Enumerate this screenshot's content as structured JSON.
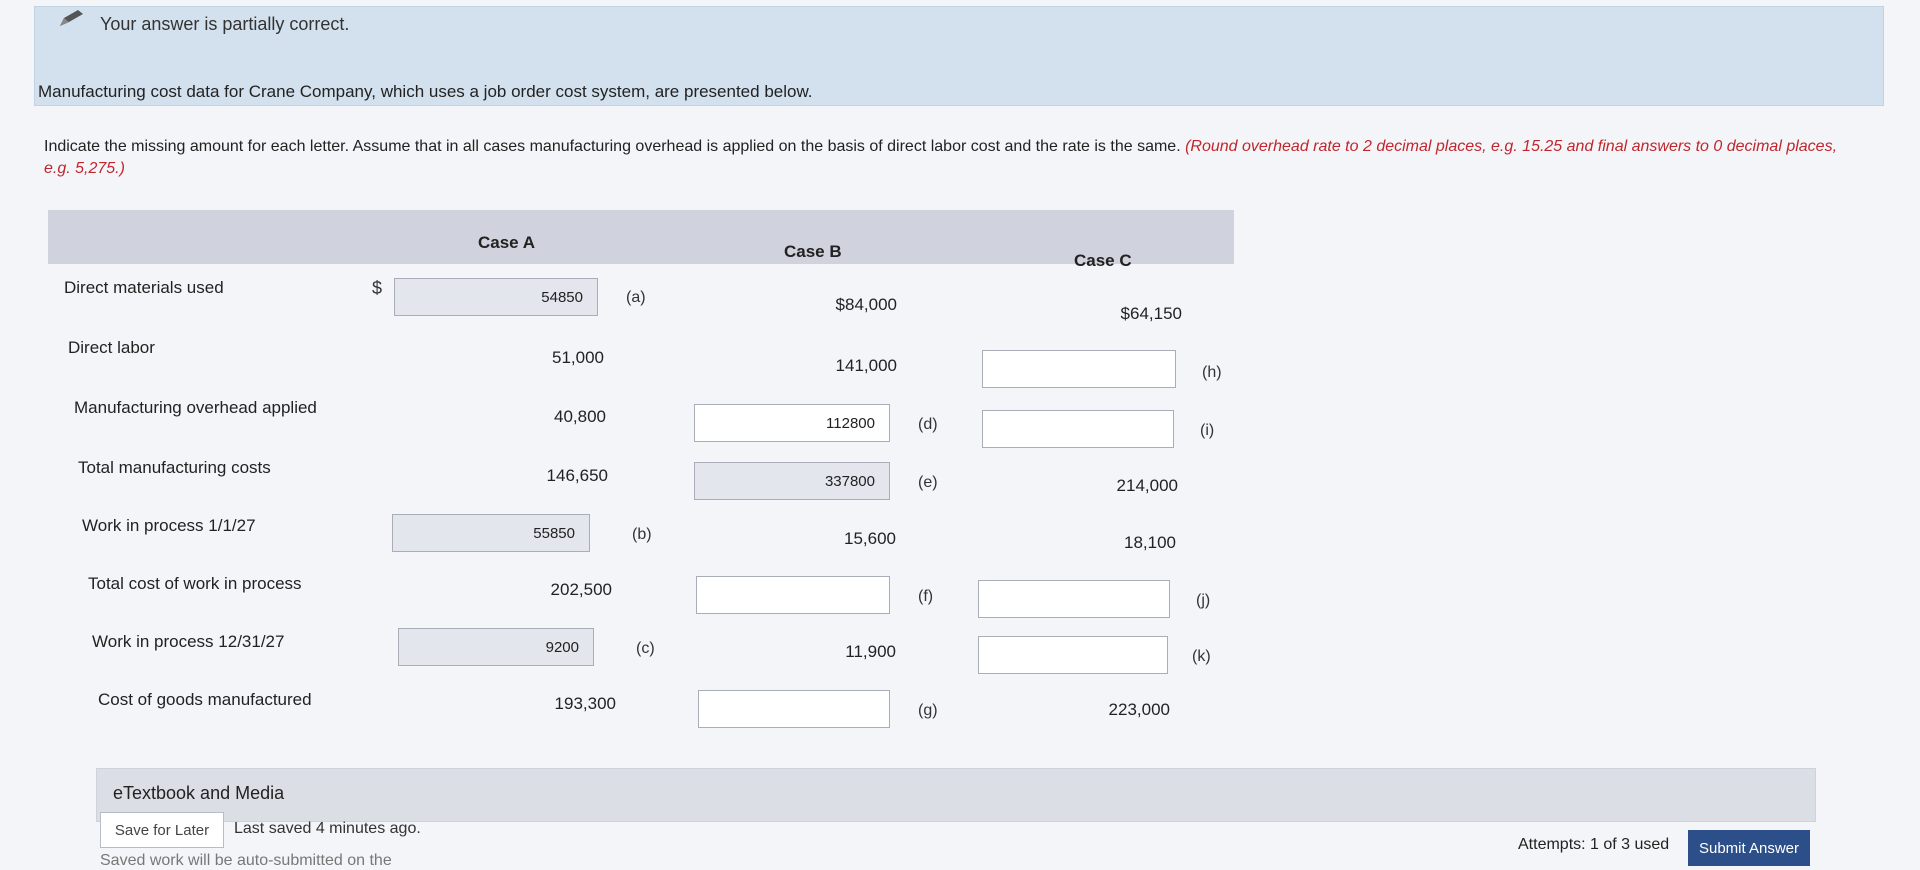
{
  "banner": {
    "text": "Your answer is partially correct.",
    "icon": "pencil-icon"
  },
  "intro": "Manufacturing cost data for Crane Company, which uses a job order cost system, are presented below.",
  "instructions": {
    "text": "Indicate the missing amount for each letter. Assume that in all cases manufacturing overhead is applied on the basis of direct labor cost and the rate is the same. ",
    "hint": "(Round overhead rate to 2 decimal places, e.g. 15.25 and final answers to 0 decimal places, e.g. 5,275.)"
  },
  "table": {
    "headers": [
      "Case A",
      "Case B",
      "Case C"
    ],
    "currency_symbol": "$",
    "rows": [
      {
        "label": "Direct materials used",
        "a": "54850",
        "a_letter": "(a)",
        "b": "$84,000",
        "c": "$64,150"
      },
      {
        "label": "Direct labor",
        "a": "51,000",
        "b": "141,000",
        "c": "",
        "c_letter": "(h)"
      },
      {
        "label": "Manufacturing overhead applied",
        "a": "40,800",
        "b": "112800",
        "b_letter": "(d)",
        "c": "",
        "c_letter": "(i)"
      },
      {
        "label": "Total manufacturing costs",
        "a": "146,650",
        "b": "337800",
        "b_letter": "(e)",
        "c": "214,000"
      },
      {
        "label": "Work in process 1/1/27",
        "a": "55850",
        "a_letter": "(b)",
        "b": "15,600",
        "c": "18,100"
      },
      {
        "label": "Total cost of work in process",
        "a": "202,500",
        "b": "",
        "b_letter": "(f)",
        "c": "",
        "c_letter": "(j)"
      },
      {
        "label": "Work in process 12/31/27",
        "a": "9200",
        "a_letter": "(c)",
        "b": "11,900",
        "c": "",
        "c_letter": "(k)"
      },
      {
        "label": "Cost of goods manufactured",
        "a": "193,300",
        "b": "",
        "b_letter": "(g)",
        "c": "223,000"
      }
    ]
  },
  "etextbook": {
    "label": "eTextbook and Media"
  },
  "footer": {
    "save_label": "Save for Later",
    "saved_text": "Last saved 4 minutes ago.",
    "cut_text": "Saved work will be auto-submitted on the",
    "attempts": "Attempts: 1 of 3 used",
    "submit_label": "Submit Answer"
  }
}
